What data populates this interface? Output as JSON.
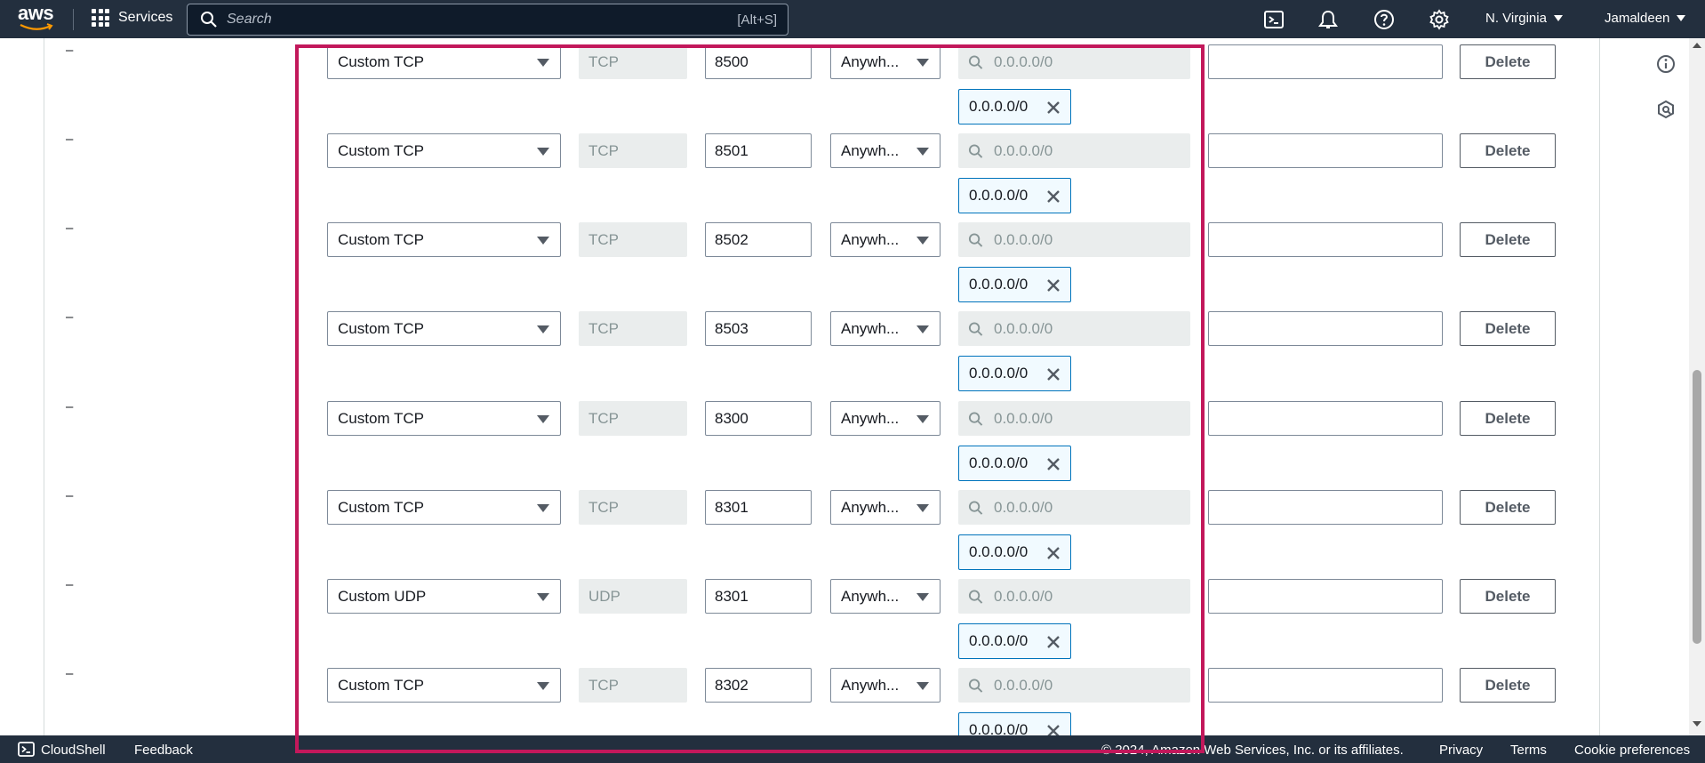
{
  "topnav": {
    "logo_text": "aws",
    "services_label": "Services",
    "search_placeholder": "Search",
    "search_shortcut": "[Alt+S]",
    "region_label": "N. Virginia",
    "account_label": "Jamaldeen"
  },
  "colors": {
    "nav_bg": "#232f3e",
    "highlight": "#c2185b",
    "token_border": "#0073bb",
    "disabled_bg": "#eaeded"
  },
  "rules": [
    {
      "dash": "–",
      "type": "Custom TCP",
      "protocol": "TCP",
      "port": "8500",
      "source": "Anywh...",
      "cidr_placeholder": "0.0.0.0/0",
      "token": "0.0.0.0/0",
      "description": "",
      "delete_label": "Delete"
    },
    {
      "dash": "–",
      "type": "Custom TCP",
      "protocol": "TCP",
      "port": "8501",
      "source": "Anywh...",
      "cidr_placeholder": "0.0.0.0/0",
      "token": "0.0.0.0/0",
      "description": "",
      "delete_label": "Delete"
    },
    {
      "dash": "–",
      "type": "Custom TCP",
      "protocol": "TCP",
      "port": "8502",
      "source": "Anywh...",
      "cidr_placeholder": "0.0.0.0/0",
      "token": "0.0.0.0/0",
      "description": "",
      "delete_label": "Delete"
    },
    {
      "dash": "–",
      "type": "Custom TCP",
      "protocol": "TCP",
      "port": "8503",
      "source": "Anywh...",
      "cidr_placeholder": "0.0.0.0/0",
      "token": "0.0.0.0/0",
      "description": "",
      "delete_label": "Delete"
    },
    {
      "dash": "–",
      "type": "Custom TCP",
      "protocol": "TCP",
      "port": "8300",
      "source": "Anywh...",
      "cidr_placeholder": "0.0.0.0/0",
      "token": "0.0.0.0/0",
      "description": "",
      "delete_label": "Delete"
    },
    {
      "dash": "–",
      "type": "Custom TCP",
      "protocol": "TCP",
      "port": "8301",
      "source": "Anywh...",
      "cidr_placeholder": "0.0.0.0/0",
      "token": "0.0.0.0/0",
      "description": "",
      "delete_label": "Delete"
    },
    {
      "dash": "–",
      "type": "Custom UDP",
      "protocol": "UDP",
      "port": "8301",
      "source": "Anywh...",
      "cidr_placeholder": "0.0.0.0/0",
      "token": "0.0.0.0/0",
      "description": "",
      "delete_label": "Delete"
    },
    {
      "dash": "–",
      "type": "Custom TCP",
      "protocol": "TCP",
      "port": "8302",
      "source": "Anywh...",
      "cidr_placeholder": "0.0.0.0/0",
      "token": "0.0.0.0/0",
      "description": "",
      "delete_label": "Delete"
    }
  ],
  "footer": {
    "cloudshell_label": "CloudShell",
    "feedback_label": "Feedback",
    "copyright": "© 2024, Amazon Web Services, Inc. or its affiliates.",
    "privacy_label": "Privacy",
    "terms_label": "Terms",
    "cookie_label": "Cookie preferences"
  }
}
